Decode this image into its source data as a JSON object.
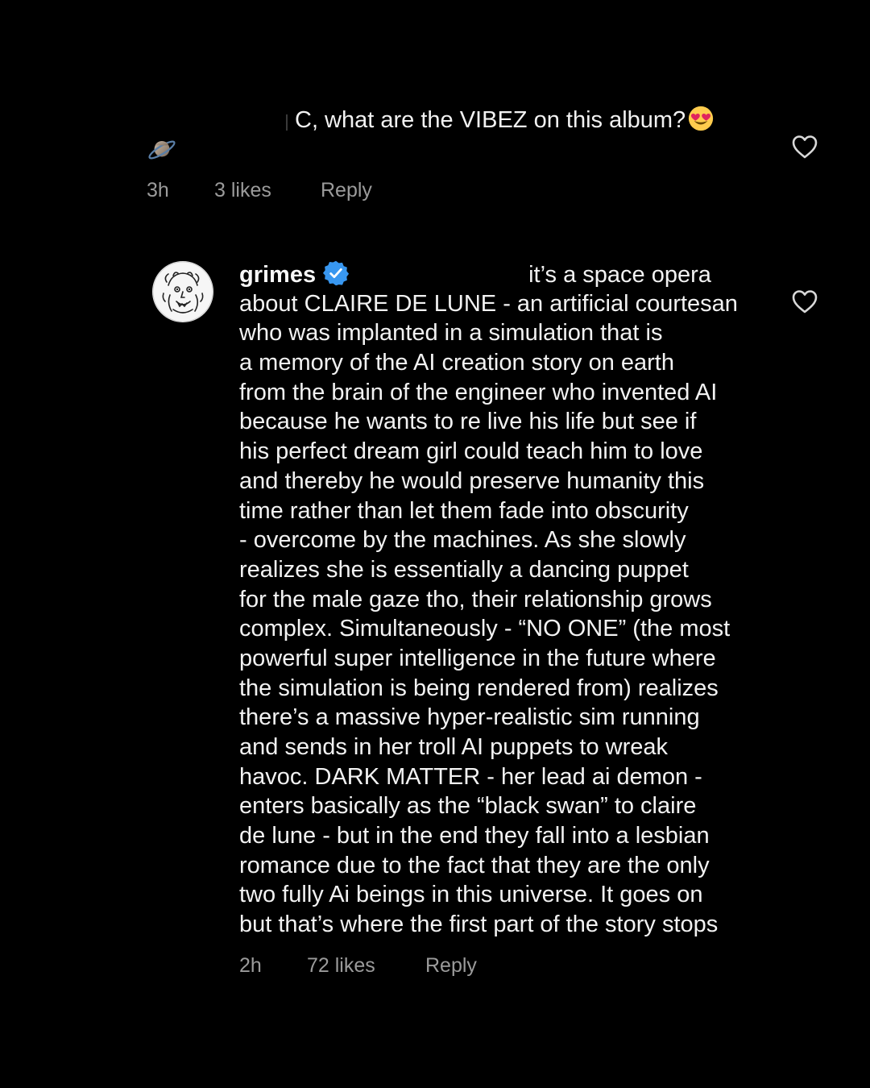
{
  "comment1": {
    "text": "C, what are the VIBEZ on this album?",
    "emoji_icon": "heart-eyes-emoji-icon",
    "avatar_icon": "saturn-planet-icon",
    "time": "3h",
    "likes": "3 likes",
    "reply_label": "Reply",
    "liked": false
  },
  "comment2": {
    "username": "grimes",
    "verified": true,
    "lines": [
      "it’s a space opera",
      "about CLAIRE DE LUNE - an artificial courtesan",
      "who was implanted in a simulation that is",
      "a memory of the AI creation story on earth",
      "from the brain of the engineer who invented AI",
      "because he wants to re live his life but see if",
      "his perfect dream girl could teach him to love",
      "and thereby he would preserve humanity this",
      "time rather than let them fade into obscurity",
      "- overcome by the machines.  As she slowly",
      "realizes she is essentially a dancing puppet",
      "for the male gaze tho, their relationship grows",
      "complex. Simultaneously - “NO ONE” (the most",
      "powerful super intelligence in the future where",
      "the simulation is being rendered from) realizes",
      "there’s a massive hyper-realistic sim running",
      "and sends in her troll AI puppets to wreak",
      "havoc.  DARK MATTER - her lead ai demon -",
      "enters basically as the “black swan” to claire",
      "de lune - but in the end they fall into a lesbian",
      "romance due to the fact that they are the only",
      "two fully Ai beings in this universe.  It goes on",
      "but that’s where the first part of the story stops"
    ],
    "time": "2h",
    "likes": "72 likes",
    "reply_label": "Reply",
    "liked": false
  },
  "colors": {
    "background": "#000000",
    "text": "#f2f2f2",
    "meta_text": "#9b9b9b",
    "verified_badge": "#3897f0",
    "heart_outline": "#d8d8d8"
  }
}
